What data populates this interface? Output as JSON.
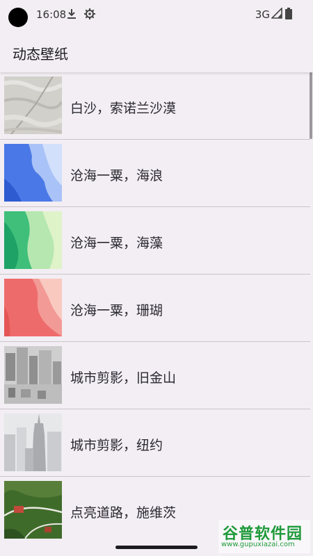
{
  "status_bar": {
    "time": "16:08",
    "network": "3G",
    "icons": [
      "download-icon",
      "settings-gear-icon",
      "signal-icon",
      "battery-icon"
    ]
  },
  "app_bar": {
    "title": "动态壁纸"
  },
  "wallpapers": [
    {
      "label": "白沙，索诺兰沙漠",
      "thumb": "sand"
    },
    {
      "label": "沧海一粟，海浪",
      "thumb": "wave"
    },
    {
      "label": "沧海一粟，海藻",
      "thumb": "kelp"
    },
    {
      "label": "沧海一粟，珊瑚",
      "thumb": "coral"
    },
    {
      "label": "城市剪影，旧金山",
      "thumb": "sf"
    },
    {
      "label": "城市剪影，纽约",
      "thumb": "ny"
    },
    {
      "label": "点亮道路，施维茨",
      "thumb": "schwyz"
    }
  ],
  "watermark": {
    "main": "谷普软件园",
    "url": "www.gupuxiazai.com"
  },
  "colors": {
    "background": "#f2eef3",
    "divider": "#c8c4cb",
    "watermark": "#1f9a3a"
  }
}
